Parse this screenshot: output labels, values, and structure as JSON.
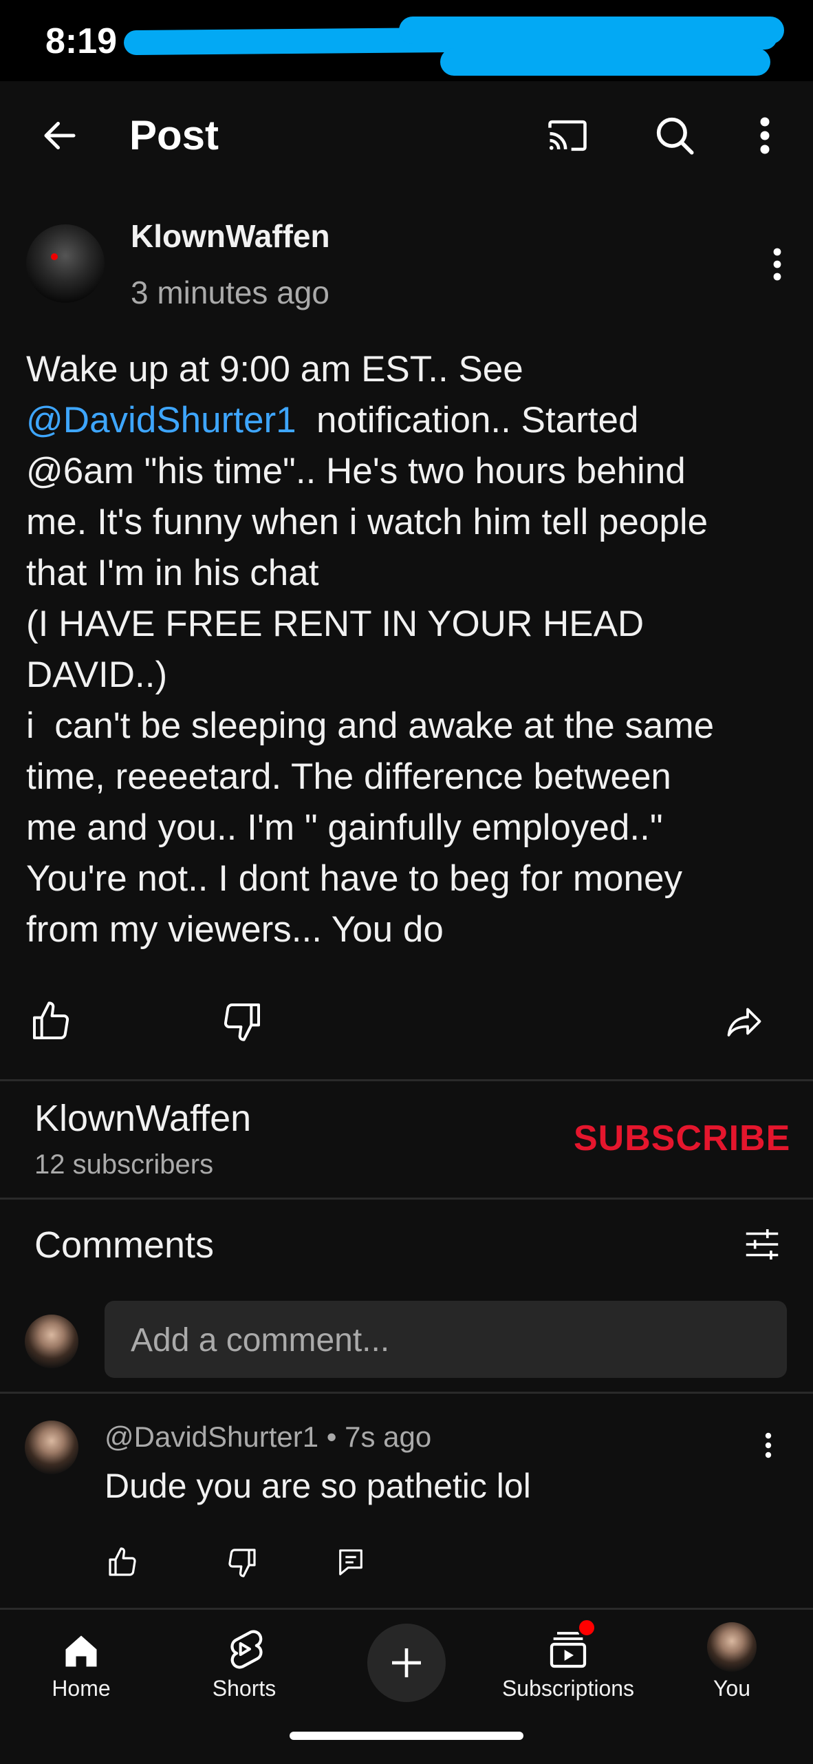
{
  "status_bar": {
    "time": "8:19"
  },
  "app_bar": {
    "title": "Post"
  },
  "post": {
    "author": "KlownWaffen",
    "time_ago": "3 minutes ago",
    "text_part1": "Wake up at 9:00 am EST.. See\n",
    "mention": "@DavidShurter1",
    "text_part2": "  notification.. Started\n@6am \"his time\".. He's two hours behind\nme. It's funny when i watch him tell people\nthat I'm in his chat\n(I HAVE FREE RENT IN YOUR HEAD\nDAVID..)\ni  can't be sleeping and awake at the same\ntime, reeeetard. The difference between\nme and you.. I'm \" gainfully employed..\"\nYou're not.. I dont have to beg for money\nfrom my viewers... You do"
  },
  "channel": {
    "name": "KlownWaffen",
    "subscribers": "12 subscribers",
    "subscribe_label": "SUBSCRIBE"
  },
  "comments": {
    "title": "Comments",
    "input_placeholder": "Add a comment...",
    "items": [
      {
        "author": "@DavidShurter1",
        "time_ago": "7s ago",
        "text": "Dude you are so pathetic lol"
      }
    ]
  },
  "nav": {
    "items": [
      {
        "label": "Home",
        "icon": "home-icon"
      },
      {
        "label": "Shorts",
        "icon": "shorts-icon"
      },
      {
        "label": "",
        "icon": "create-plus-icon"
      },
      {
        "label": "Subscriptions",
        "icon": "subscriptions-icon"
      },
      {
        "label": "You",
        "icon": "avatar"
      }
    ]
  },
  "colors": {
    "background": "#0f0f0f",
    "mention": "#3ea6ff",
    "subscribe": "#e5162d",
    "notification_dot": "#ff0000"
  }
}
